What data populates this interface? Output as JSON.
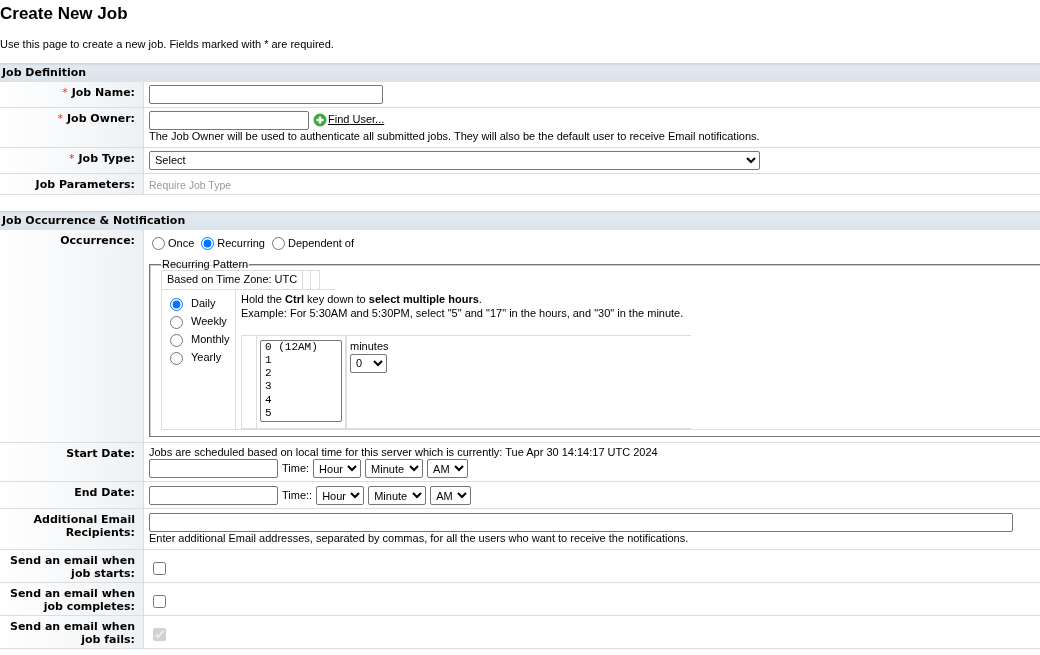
{
  "page": {
    "title": "Create New Job",
    "intro": "Use this page to create a new job. Fields marked with * are required."
  },
  "sections": [
    {
      "title": "Job Definition",
      "rows": [
        {
          "kind": "text",
          "required_mark": "*",
          "label": "Job Name:"
        },
        {
          "kind": "owner",
          "required_mark": "*",
          "label": "Job Owner:",
          "link": "Find User...",
          "help": "The Job Owner will be used to authenticate all submitted jobs. They will also be the default user to receive Email notifications."
        },
        {
          "kind": "select",
          "required_mark": "*",
          "label": "Job Type:",
          "value": "Select"
        },
        {
          "kind": "note",
          "label": "Job Parameters:",
          "note": "Require Job Type"
        }
      ]
    },
    {
      "title": "Job Occurrence & Notification",
      "rows": [
        {
          "kind": "occurrence",
          "label": "Occurrence:",
          "options": [
            {
              "label": "Once",
              "selected": false
            },
            {
              "label": "Recurring",
              "selected": true
            },
            {
              "label": "Dependent of",
              "selected": false
            }
          ],
          "pattern": {
            "legend": "Recurring Pattern",
            "timezone": "Based on Time Zone: UTC",
            "frequencies": [
              {
                "label": "Daily",
                "selected": true
              },
              {
                "label": "Weekly",
                "selected": false
              },
              {
                "label": "Monthly",
                "selected": false
              },
              {
                "label": "Yearly",
                "selected": false
              }
            ],
            "hint": "Hold the **Ctrl** key down to **select multiple hours**.",
            "example": "Example: For 5:30AM and 5:30PM, select \"5\" and \"17\" in the hours, and \"30\" in the minute.",
            "hours": [
              "0 (12AM)",
              "1",
              "2",
              "3",
              "4",
              "5"
            ],
            "minutes_label": "minutes",
            "minutes_value": "0"
          }
        },
        {
          "kind": "date",
          "label": "Start Date:",
          "note": "Jobs are scheduled based on local time for this server which is currently: Tue Apr 30 14:14:17 UTC 2024",
          "time_label": "Time:",
          "hour": "Hour",
          "minute": "Minute",
          "ampm": "AM"
        },
        {
          "kind": "date",
          "label": "End Date:",
          "time_label": "Time::",
          "hour": "Hour",
          "minute": "Minute",
          "ampm": "AM"
        },
        {
          "kind": "email",
          "label": "Additional Email Recipients:",
          "help": "Enter additional Email addresses, separated by commas, for all the users who want to receive the notifications."
        },
        {
          "kind": "check",
          "label": "Send an email when job starts:",
          "checked": false,
          "disabled": false
        },
        {
          "kind": "check",
          "label": "Send an email when job completes:",
          "checked": false,
          "disabled": false
        },
        {
          "kind": "check",
          "label": "Send an email when job fails:",
          "checked": true,
          "disabled": true
        }
      ]
    }
  ]
}
